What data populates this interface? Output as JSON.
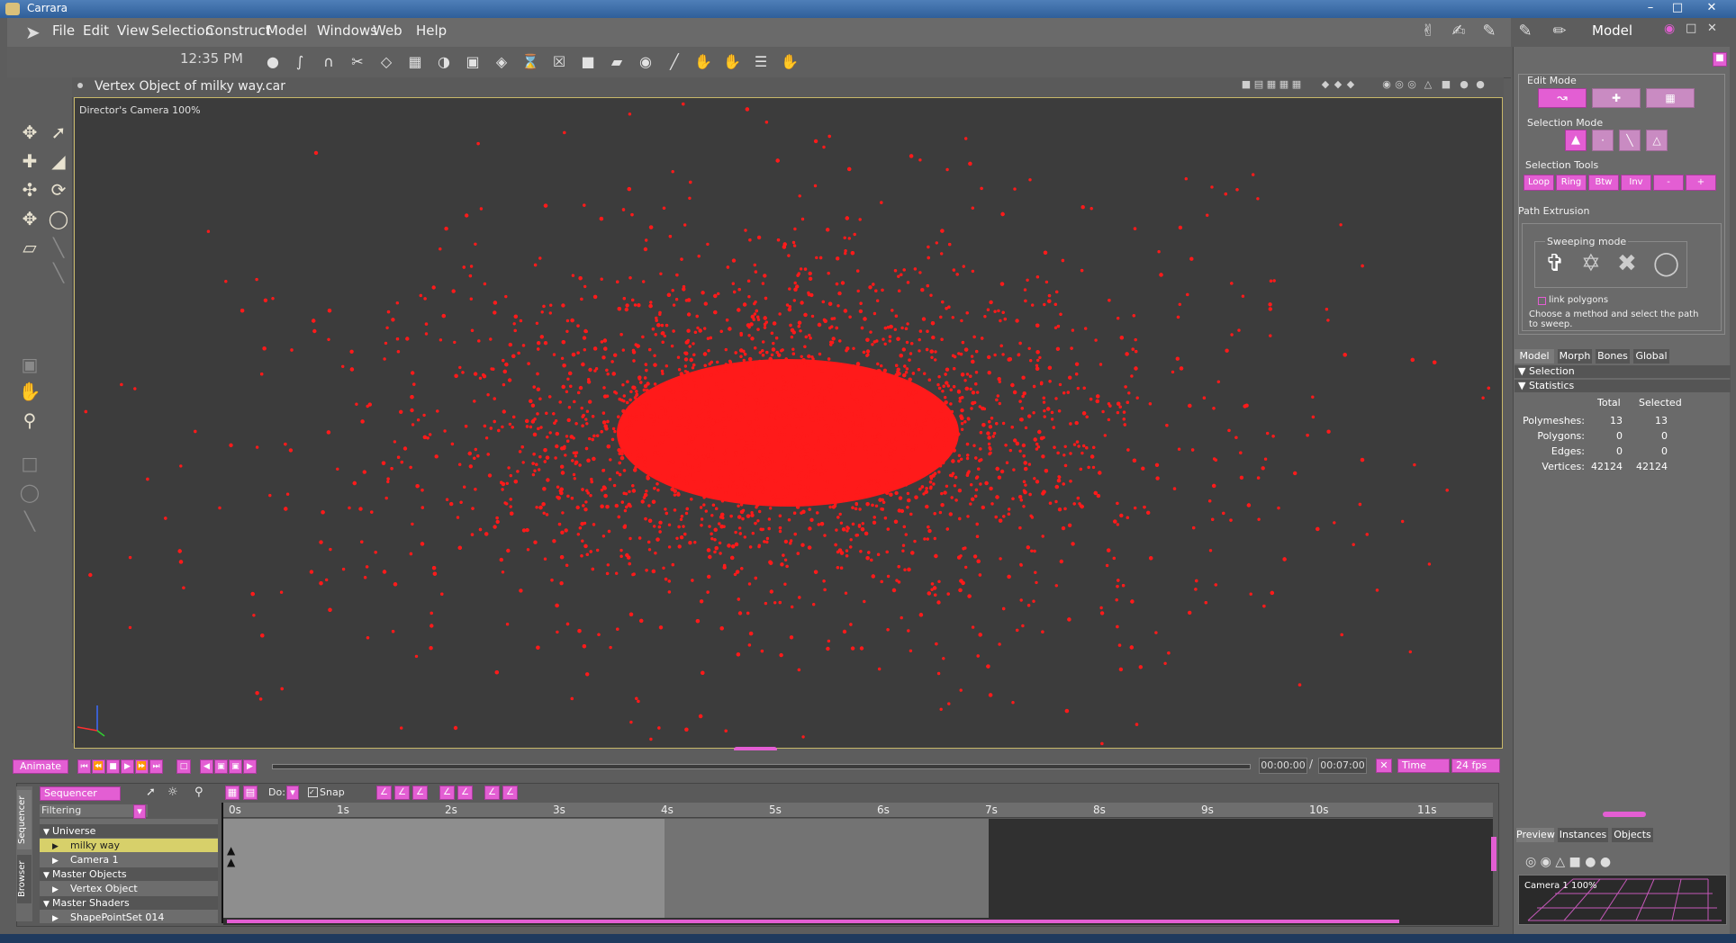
{
  "window": {
    "title": "Carrara"
  },
  "menu": [
    "File",
    "Edit",
    "View",
    "Selection",
    "Construct",
    "Model",
    "Windows",
    "Web",
    "Help"
  ],
  "room_label": "Model",
  "clock": "12:35 PM",
  "viewport": {
    "title": "Vertex Object of milky way.car",
    "camera_label": "Director's Camera 100%",
    "point_color": "#ff1a1a",
    "background": "#3c3c3c"
  },
  "animation": {
    "animate_label": "Animate",
    "current_time": "00:00:00",
    "separator": "/",
    "end_time": "00:07:00",
    "time_mode": "Time",
    "fps": "24 fps"
  },
  "sequencer": {
    "mode": "Sequencer",
    "filtering": "Filtering",
    "do_label": "Do:",
    "snap_label": "Snap",
    "side_tabs": [
      "Sequencer",
      "Browser"
    ],
    "ruler": [
      "0s",
      "1s",
      "2s",
      "3s",
      "4s",
      "5s",
      "6s",
      "7s",
      "8s",
      "9s",
      "10s",
      "11s"
    ],
    "tree": [
      {
        "label": "Universe",
        "type": "hdr"
      },
      {
        "label": "milky way",
        "type": "sel"
      },
      {
        "label": "Camera 1",
        "type": "item"
      },
      {
        "label": "Master Objects",
        "type": "hdr"
      },
      {
        "label": "Vertex Object",
        "type": "item"
      },
      {
        "label": "Master Shaders",
        "type": "hdr"
      },
      {
        "label": "ShapePointSet 014",
        "type": "item"
      }
    ]
  },
  "right_panel": {
    "edit_mode": "Edit Mode",
    "selection_mode": "Selection Mode",
    "selection_tools": "Selection Tools",
    "tool_buttons": [
      "Loop",
      "Ring",
      "Btw",
      "Inv",
      "-",
      "+"
    ],
    "path_extrusion": "Path Extrusion",
    "sweeping_mode": "Sweeping mode",
    "link_polygons": "link polygons",
    "hint": "Choose a method and select the path to sweep.",
    "tabs": [
      "Model",
      "Morph",
      "Bones",
      "Global"
    ],
    "sections": [
      "Selection",
      "Statistics"
    ],
    "stats_headers": [
      "Total",
      "Selected"
    ],
    "stats": [
      {
        "label": "Polymeshes:",
        "total": "13",
        "selected": "13"
      },
      {
        "label": "Polygons:",
        "total": "0",
        "selected": "0"
      },
      {
        "label": "Edges:",
        "total": "0",
        "selected": "0"
      },
      {
        "label": "Vertices:",
        "total": "42124",
        "selected": "42124"
      }
    ],
    "bottom_tabs": [
      "Preview",
      "Instances",
      "Objects"
    ],
    "preview_label": "Camera 1 100%"
  },
  "accent": "#e35ed3"
}
